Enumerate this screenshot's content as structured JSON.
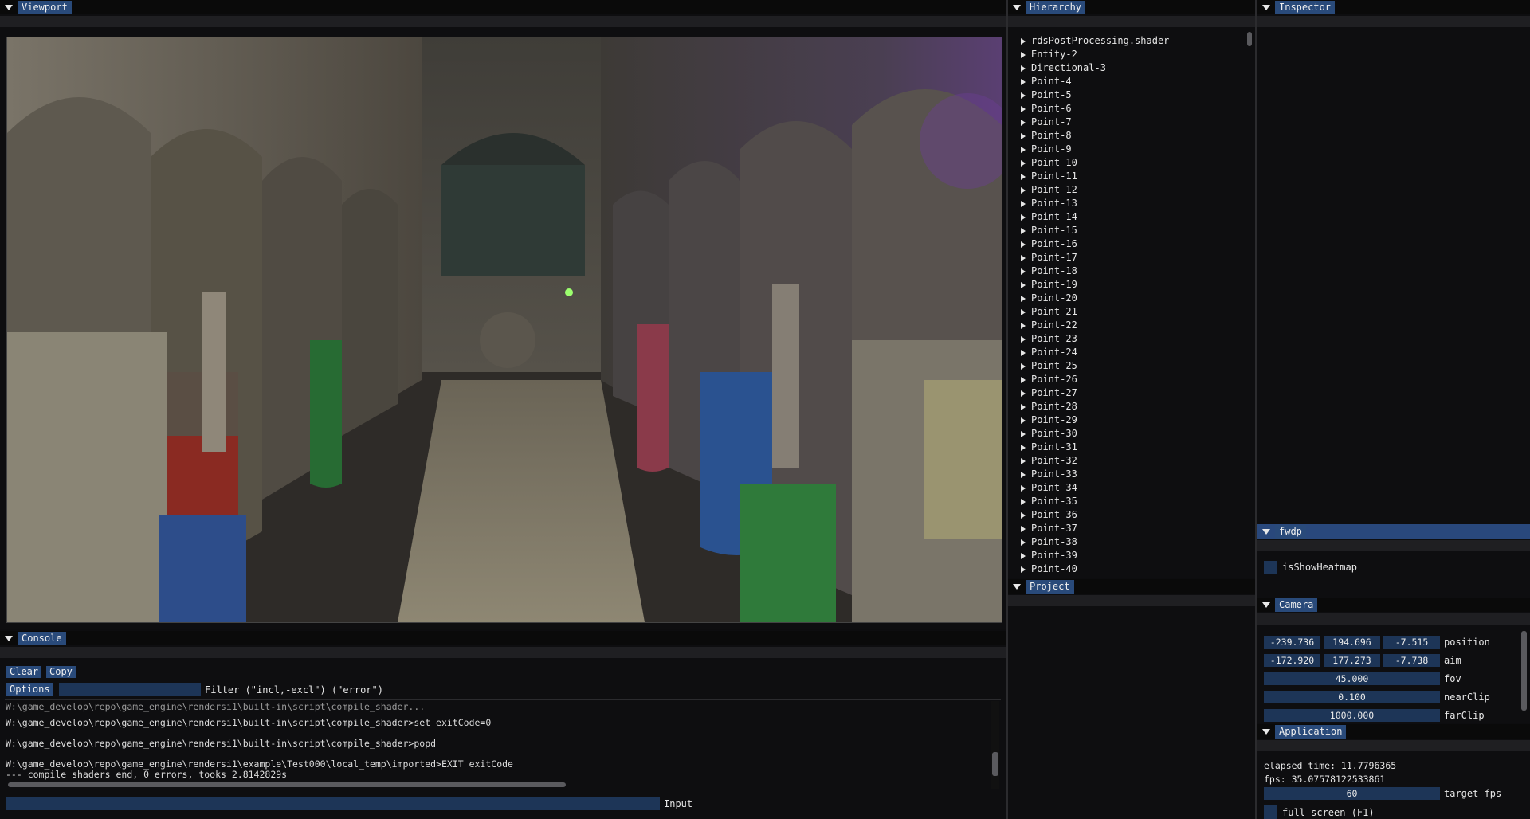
{
  "viewport": {
    "title": "Viewport"
  },
  "console": {
    "title": "Console",
    "clear_label": "Clear",
    "copy_label": "Copy",
    "options_label": "Options",
    "filter_value": "",
    "filter_label": "Filter (\"incl,-excl\") (\"error\")",
    "log_lines": [
      "W:\\game_develop\\repo\\game_engine\\rendersi1\\built-in\\script\\compile_shader>set exitCode=0",
      "W:\\game_develop\\repo\\game_engine\\rendersi1\\built-in\\script\\compile_shader>popd",
      "W:\\game_develop\\repo\\game_engine\\rendersi1\\example\\Test000\\local_temp\\imported>EXIT exitCode",
      "--- compile shaders end, 0 errors, tooks 2.8142829s"
    ],
    "input_value": "",
    "input_label": "Input"
  },
  "hierarchy": {
    "title": "Hierarchy",
    "items": [
      "rdsPostProcessing.shader",
      "Entity-2",
      "Directional-3",
      "Point-4",
      "Point-5",
      "Point-6",
      "Point-7",
      "Point-8",
      "Point-9",
      "Point-10",
      "Point-11",
      "Point-12",
      "Point-13",
      "Point-14",
      "Point-15",
      "Point-16",
      "Point-17",
      "Point-18",
      "Point-19",
      "Point-20",
      "Point-21",
      "Point-22",
      "Point-23",
      "Point-24",
      "Point-25",
      "Point-26",
      "Point-27",
      "Point-28",
      "Point-29",
      "Point-30",
      "Point-31",
      "Point-32",
      "Point-33",
      "Point-34",
      "Point-35",
      "Point-36",
      "Point-37",
      "Point-38",
      "Point-39",
      "Point-40"
    ]
  },
  "project": {
    "title": "Project"
  },
  "inspector": {
    "title": "Inspector"
  },
  "fwdp": {
    "title": "fwdp",
    "show_heatmap_label": "isShowHeatmap",
    "show_heatmap_checked": false
  },
  "camera": {
    "title": "Camera",
    "position": [
      "-239.736",
      "194.696",
      "-7.515"
    ],
    "position_label": "position",
    "aim": [
      "-172.920",
      "177.273",
      "-7.738"
    ],
    "aim_label": "aim",
    "fov": "45.000",
    "fov_label": "fov",
    "near_clip": "0.100",
    "near_clip_label": "nearClip",
    "far_clip": "1000.000",
    "far_clip_label": "farClip"
  },
  "application": {
    "title": "Application",
    "elapsed": "elapsed time: 11.7796365",
    "fps": "fps: 35.07578122533861",
    "target_fps": "60",
    "target_fps_label": "target fps",
    "full_screen_label": "full screen (F1)"
  },
  "colors": {
    "accent": "#294a7a",
    "field": "#1d3557",
    "background": "#0e0e10"
  }
}
